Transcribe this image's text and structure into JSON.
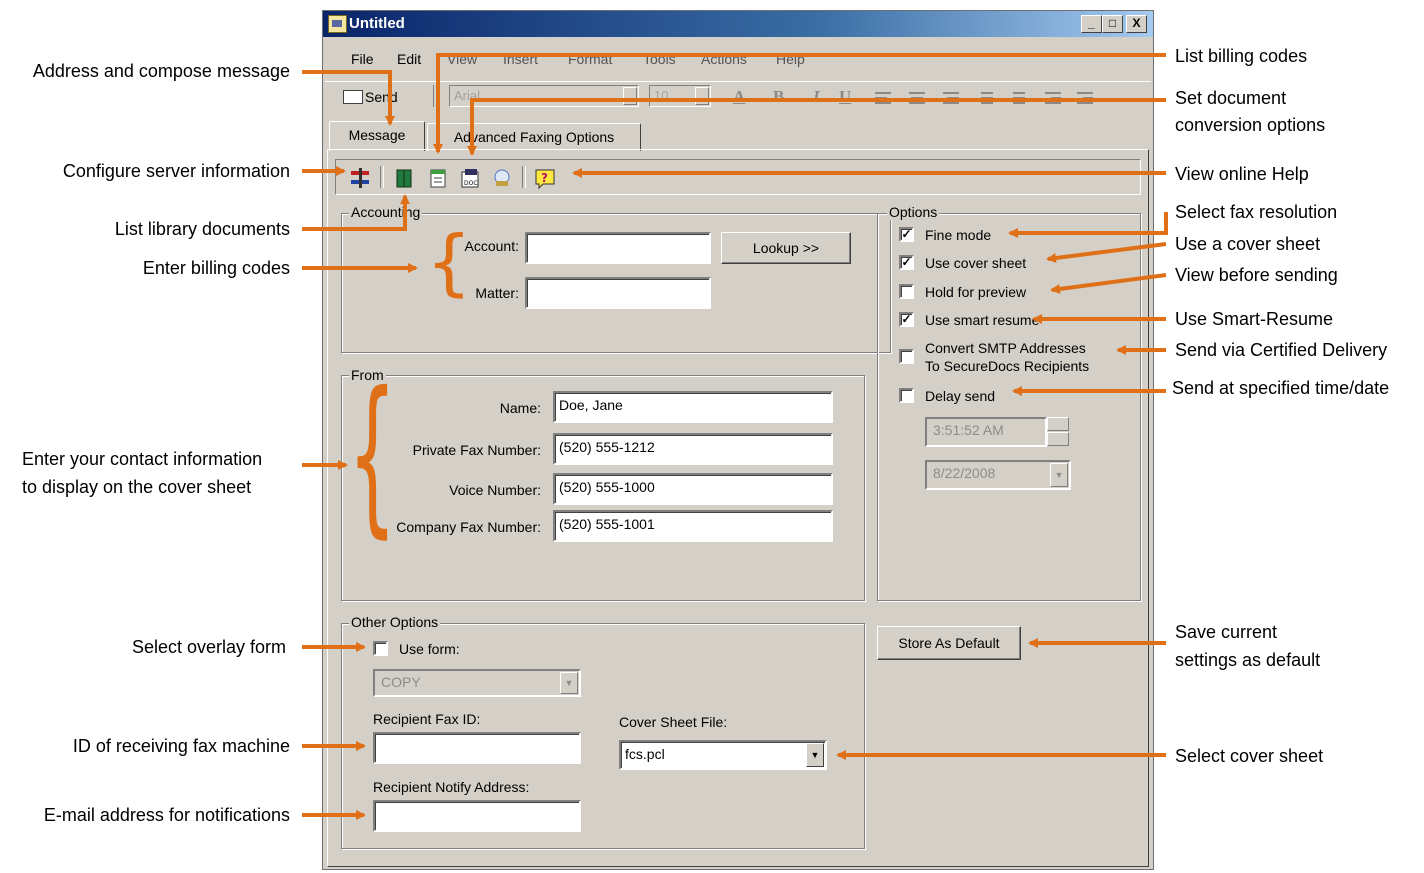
{
  "window": {
    "title": "Untitled",
    "controls": [
      "_",
      "□",
      "X"
    ]
  },
  "menu": [
    "File",
    "Edit",
    "View",
    "Insert",
    "Format",
    "Tools",
    "Actions",
    "Help"
  ],
  "toolbar": {
    "send_label": "Send",
    "font": "Arial",
    "size": "10",
    "format_glyphs": [
      "A",
      "B",
      "I",
      "U"
    ]
  },
  "tabs": [
    "Message",
    "Advanced Faxing Options"
  ],
  "icon_toolbar": {
    "icons": [
      "server-config-icon",
      "library-documents-icon",
      "billing-codes-icon",
      "document-conversion-icon",
      "address-book-icon",
      "help-icon"
    ]
  },
  "accounting": {
    "group_label": "Accounting",
    "account_label": "Account:",
    "account_value": "",
    "matter_label": "Matter:",
    "matter_value": "",
    "lookup_label": "Lookup  >>"
  },
  "from": {
    "group_label": "From",
    "name_label": "Name:",
    "name_value": "Doe, Jane",
    "private_fax_label": "Private Fax Number:",
    "private_fax_value": "(520) 555-1212",
    "voice_label": "Voice Number:",
    "voice_value": "(520) 555-1000",
    "company_fax_label": "Company Fax Number:",
    "company_fax_value": "(520) 555-1001"
  },
  "options": {
    "group_label": "Options",
    "fine_mode": "Fine mode",
    "cover_sheet": "Use cover sheet",
    "hold": "Hold for preview",
    "smart": "Use smart resume",
    "smtp_line1": "Convert SMTP Addresses",
    "smtp_line2": "To SecureDocs Recipients",
    "delay": "Delay send",
    "time": "3:51:52 AM",
    "date": "8/22/2008",
    "checked": {
      "fine_mode": true,
      "cover_sheet": true,
      "hold": false,
      "smart": true,
      "smtp": false,
      "delay": false
    }
  },
  "store_default": "Store As Default",
  "other": {
    "group_label": "Other Options",
    "use_form": "Use form:",
    "form_value": "COPY",
    "fax_id_label": "Recipient Fax ID:",
    "fax_id_value": "",
    "cover_file_label": "Cover Sheet File:",
    "cover_file_value": "fcs.pcl",
    "notify_label": "Recipient Notify Address:",
    "notify_value": ""
  },
  "annotations": {
    "address_compose": "Address and compose message",
    "configure_server": "Configure server information",
    "list_library": "List library documents",
    "enter_billing": "Enter billing codes",
    "contact_line1": "Enter your contact information",
    "contact_line2": "to display on the cover sheet",
    "overlay": "Select overlay form",
    "fax_id": "ID of receiving fax machine",
    "email_notify": "E-mail address for notifications",
    "list_billing": "List billing codes",
    "doc_conv_line1": "Set document",
    "doc_conv_line2": "conversion options",
    "online_help": "View online Help",
    "fax_resolution": "Select fax resolution",
    "use_cover": "Use a cover sheet",
    "view_before": "View before sending",
    "smart_resume": "Use Smart-Resume",
    "certified": "Send via Certified Delivery",
    "specified_time": "Send at specified time/date",
    "save_line1": "Save current",
    "save_line2": "settings as default",
    "select_cover": "Select cover sheet"
  },
  "colors": {
    "arrow": "#e07018",
    "window_bg": "#d4d0c8",
    "titlebar": "#0a246a"
  }
}
